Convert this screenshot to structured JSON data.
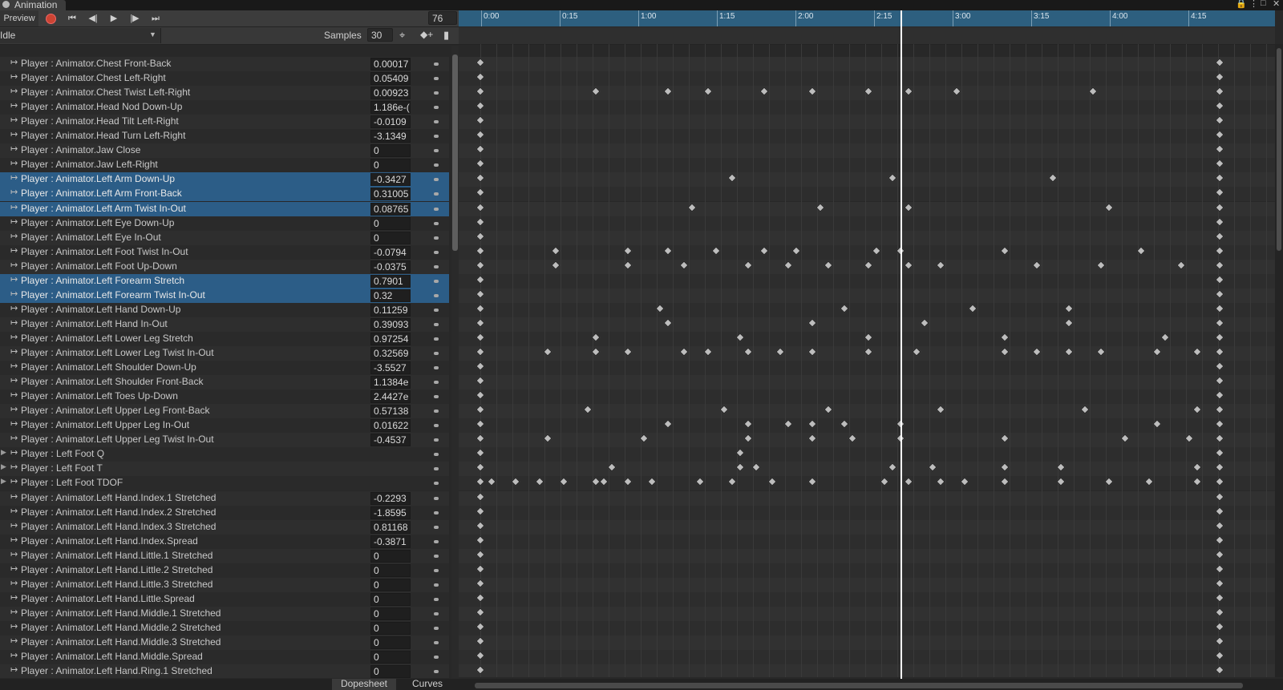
{
  "window": {
    "title": "Animation"
  },
  "toolbar": {
    "preview_label": "Preview",
    "frame_value": "76",
    "clip_name": "Idle",
    "samples_label": "Samples",
    "samples_value": "30"
  },
  "timeline": {
    "ticks": [
      "0:00",
      "0:15",
      "1:00",
      "1:15",
      "2:00",
      "2:15",
      "3:00",
      "3:15",
      "4:00",
      "4:15"
    ]
  },
  "properties": [
    {
      "name": "Player : Animator.Chest Front-Back",
      "value": "0.00017",
      "selected": false,
      "type": "curve"
    },
    {
      "name": "Player : Animator.Chest Left-Right",
      "value": "0.05409",
      "selected": false,
      "type": "curve"
    },
    {
      "name": "Player : Animator.Chest Twist Left-Right",
      "value": "0.00923",
      "selected": false,
      "type": "curve"
    },
    {
      "name": "Player : Animator.Head Nod Down-Up",
      "value": "1.186e-(",
      "selected": false,
      "type": "curve"
    },
    {
      "name": "Player : Animator.Head Tilt Left-Right",
      "value": "-0.0109",
      "selected": false,
      "type": "curve"
    },
    {
      "name": "Player : Animator.Head Turn Left-Right",
      "value": "-3.1349",
      "selected": false,
      "type": "curve"
    },
    {
      "name": "Player : Animator.Jaw Close",
      "value": "0",
      "selected": false,
      "type": "curve"
    },
    {
      "name": "Player : Animator.Jaw Left-Right",
      "value": "0",
      "selected": false,
      "type": "curve"
    },
    {
      "name": "Player : Animator.Left Arm Down-Up",
      "value": "-0.3427",
      "selected": true,
      "type": "curve"
    },
    {
      "name": "Player : Animator.Left Arm Front-Back",
      "value": "0.31005",
      "selected": true,
      "type": "curve"
    },
    {
      "name": "Player : Animator.Left Arm Twist In-Out",
      "value": "0.08765",
      "selected": true,
      "type": "curve"
    },
    {
      "name": "Player : Animator.Left Eye Down-Up",
      "value": "0",
      "selected": false,
      "type": "curve"
    },
    {
      "name": "Player : Animator.Left Eye In-Out",
      "value": "0",
      "selected": false,
      "type": "curve"
    },
    {
      "name": "Player : Animator.Left Foot Twist In-Out",
      "value": "-0.0794",
      "selected": false,
      "type": "curve"
    },
    {
      "name": "Player : Animator.Left Foot Up-Down",
      "value": "-0.0375",
      "selected": false,
      "type": "curve"
    },
    {
      "name": "Player : Animator.Left Forearm Stretch",
      "value": "0.7901",
      "selected": true,
      "type": "curve"
    },
    {
      "name": "Player : Animator.Left Forearm Twist In-Out",
      "value": "0.32",
      "selected": true,
      "type": "curve"
    },
    {
      "name": "Player : Animator.Left Hand Down-Up",
      "value": "0.11259",
      "selected": false,
      "type": "curve"
    },
    {
      "name": "Player : Animator.Left Hand In-Out",
      "value": "0.39093",
      "selected": false,
      "type": "curve"
    },
    {
      "name": "Player : Animator.Left Lower Leg Stretch",
      "value": "0.97254",
      "selected": false,
      "type": "curve"
    },
    {
      "name": "Player : Animator.Left Lower Leg Twist In-Out",
      "value": "0.32569",
      "selected": false,
      "type": "curve"
    },
    {
      "name": "Player : Animator.Left Shoulder Down-Up",
      "value": "-3.5527",
      "selected": false,
      "type": "curve"
    },
    {
      "name": "Player : Animator.Left Shoulder Front-Back",
      "value": "1.1384e",
      "selected": false,
      "type": "curve"
    },
    {
      "name": "Player : Animator.Left Toes Up-Down",
      "value": "2.4427e",
      "selected": false,
      "type": "curve"
    },
    {
      "name": "Player : Animator.Left Upper Leg Front-Back",
      "value": "0.57138",
      "selected": false,
      "type": "curve"
    },
    {
      "name": "Player : Animator.Left Upper Leg In-Out",
      "value": "0.01622",
      "selected": false,
      "type": "curve"
    },
    {
      "name": "Player : Animator.Left Upper Leg Twist In-Out",
      "value": "-0.4537",
      "selected": false,
      "type": "curve"
    },
    {
      "name": "Player : Left Foot Q",
      "value": "",
      "selected": false,
      "type": "group"
    },
    {
      "name": "Player : Left Foot T",
      "value": "",
      "selected": false,
      "type": "group"
    },
    {
      "name": "Player : Left Foot TDOF",
      "value": "",
      "selected": false,
      "type": "group"
    },
    {
      "name": "Player : Animator.Left Hand.Index.1 Stretched",
      "value": "-0.2293",
      "selected": false,
      "type": "curve"
    },
    {
      "name": "Player : Animator.Left Hand.Index.2 Stretched",
      "value": "-1.8595",
      "selected": false,
      "type": "curve"
    },
    {
      "name": "Player : Animator.Left Hand.Index.3 Stretched",
      "value": "0.81168",
      "selected": false,
      "type": "curve"
    },
    {
      "name": "Player : Animator.Left Hand.Index.Spread",
      "value": "-0.3871",
      "selected": false,
      "type": "curve"
    },
    {
      "name": "Player : Animator.Left Hand.Little.1 Stretched",
      "value": "0",
      "selected": false,
      "type": "curve"
    },
    {
      "name": "Player : Animator.Left Hand.Little.2 Stretched",
      "value": "0",
      "selected": false,
      "type": "curve"
    },
    {
      "name": "Player : Animator.Left Hand.Little.3 Stretched",
      "value": "0",
      "selected": false,
      "type": "curve"
    },
    {
      "name": "Player : Animator.Left Hand.Little.Spread",
      "value": "0",
      "selected": false,
      "type": "curve"
    },
    {
      "name": "Player : Animator.Left Hand.Middle.1 Stretched",
      "value": "0",
      "selected": false,
      "type": "curve"
    },
    {
      "name": "Player : Animator.Left Hand.Middle.2 Stretched",
      "value": "0",
      "selected": false,
      "type": "curve"
    },
    {
      "name": "Player : Animator.Left Hand.Middle.3 Stretched",
      "value": "0",
      "selected": false,
      "type": "curve"
    },
    {
      "name": "Player : Animator.Left Hand.Middle.Spread",
      "value": "0",
      "selected": false,
      "type": "curve"
    },
    {
      "name": "Player : Animator.Left Hand.Ring.1 Stretched",
      "value": "0",
      "selected": false,
      "type": "curve"
    }
  ],
  "bottom_tabs": {
    "dopesheet": "Dopesheet",
    "curves": "Curves"
  }
}
